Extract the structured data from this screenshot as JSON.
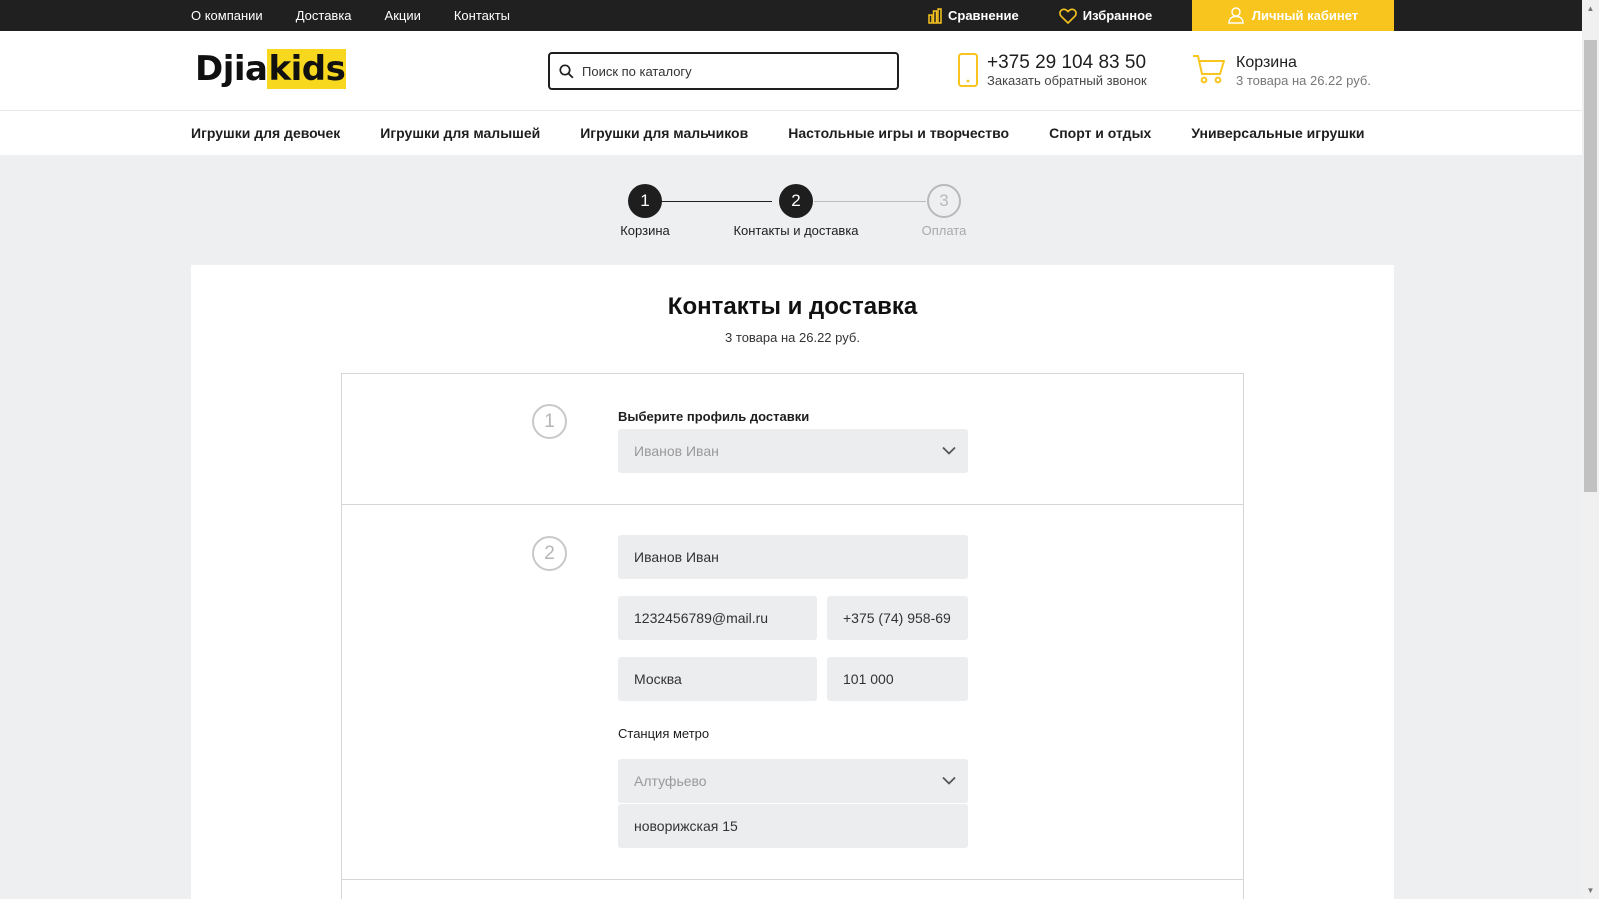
{
  "topbar": {
    "links": [
      "О компании",
      "Доставка",
      "Акции",
      "Контакты"
    ],
    "compare_label": "Сравнение",
    "favorites_label": "Избранное",
    "cabinet_label": "Личный кабинет"
  },
  "header": {
    "logo_part1": "Djia",
    "logo_part2": "kids",
    "search_placeholder": "Поиск по каталогу",
    "phone_number": "+375 29 104 83 50",
    "callback_label": "Заказать обратный звонок",
    "cart_title": "Корзина",
    "cart_summary": "3 товара на 26.22 руб."
  },
  "nav": {
    "items": [
      "Игрушки для девочек",
      "Игрушки для малышей",
      "Игрушки для мальчиков",
      "Настольные игры и творчество",
      "Спорт и отдых",
      "Универсальные игрушки"
    ]
  },
  "steps": [
    {
      "number": "1",
      "label": "Корзина",
      "state": "done"
    },
    {
      "number": "2",
      "label": "Контакты и доставка",
      "state": "active"
    },
    {
      "number": "3",
      "label": "Оплата",
      "state": "inactive"
    }
  ],
  "page": {
    "title": "Контакты и доставка",
    "subtitle": "3 товара на 26.22 руб."
  },
  "form": {
    "section1": {
      "number": "1",
      "label": "Выберите профиль доставки",
      "selected_profile": "Иванов Иван"
    },
    "section2": {
      "number": "2",
      "name": "Иванов Иван",
      "email": "1232456789@mail.ru",
      "phone": "+375 (74) 958-69",
      "city": "Москва",
      "zip": "101 000",
      "metro_label": "Станция метро",
      "metro_selected": "Алтуфьево",
      "address": "новорижская 15"
    }
  },
  "colors": {
    "accent": "#f7c51e",
    "dark": "#202020",
    "field_bg": "#ecedef"
  }
}
